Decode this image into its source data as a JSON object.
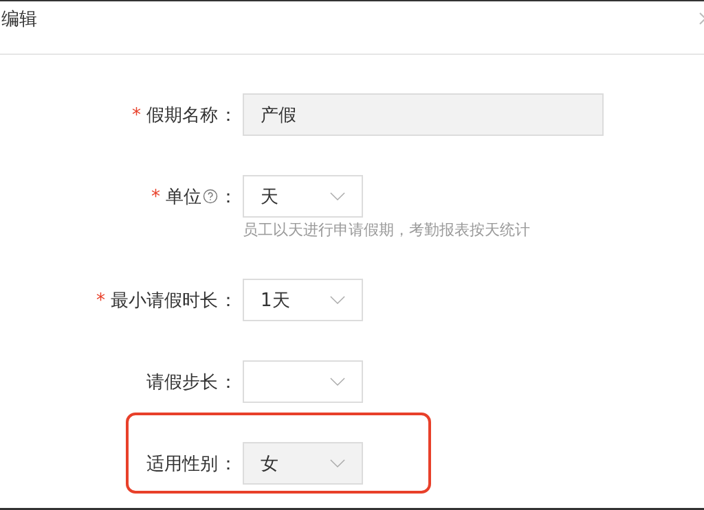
{
  "dialog": {
    "title": "编辑"
  },
  "fields": [
    {
      "kind": "text",
      "label": "假期名称",
      "required": true,
      "help_icon": false,
      "value": "产假",
      "disabled": true,
      "highlighted": false
    },
    {
      "kind": "select",
      "label": "单位",
      "required": true,
      "help_icon": true,
      "value": "天",
      "disabled": false,
      "highlighted": false,
      "hint": "员工以天进行申请假期，考勤报表按天统计"
    },
    {
      "kind": "select",
      "label": "最小请假时长",
      "required": true,
      "help_icon": false,
      "value": "1天",
      "disabled": false,
      "highlighted": false
    },
    {
      "kind": "select",
      "label": "请假步长",
      "required": false,
      "help_icon": false,
      "disabled": false,
      "highlighted": false
    },
    {
      "kind": "select",
      "label": "适用性别",
      "required": false,
      "help_icon": false,
      "value": "女",
      "disabled": true,
      "highlighted": true
    }
  ],
  "colon": "：",
  "required_mark": "*"
}
